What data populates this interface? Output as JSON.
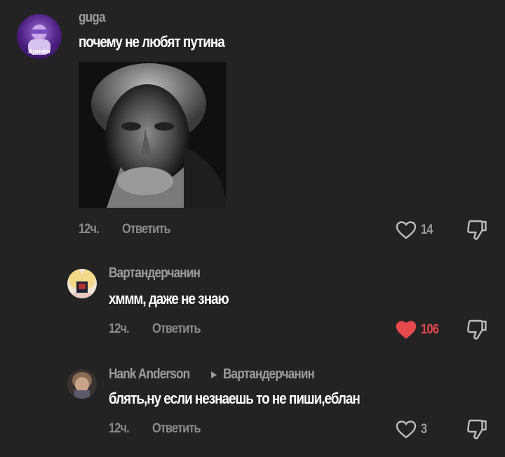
{
  "comments": [
    {
      "username": "guga",
      "avatar_badge": "Артём",
      "text": "почему не любят путина",
      "time": "12ч.",
      "reply_label": "Ответить",
      "likes": "14",
      "liked": false
    },
    {
      "username": "Вартандерчанин",
      "text": "хммм, даже не знаю",
      "time": "12ч.",
      "reply_label": "Ответить",
      "likes": "106",
      "liked": true
    },
    {
      "username": "Hank Anderson",
      "reply_to": "Вартандерчанин",
      "text": "блять,ну если незнаешь то не пиши,еблан",
      "time": "12ч.",
      "reply_label": "Ответить",
      "likes": "3",
      "liked": false
    }
  ],
  "icons": {
    "like": "heart-icon",
    "dislike": "thumbs-down-icon",
    "reply_arrow": "triangle-right-icon"
  },
  "colors": {
    "background": "#232323",
    "liked": "#e5484d",
    "muted": "#9b9b9b"
  }
}
